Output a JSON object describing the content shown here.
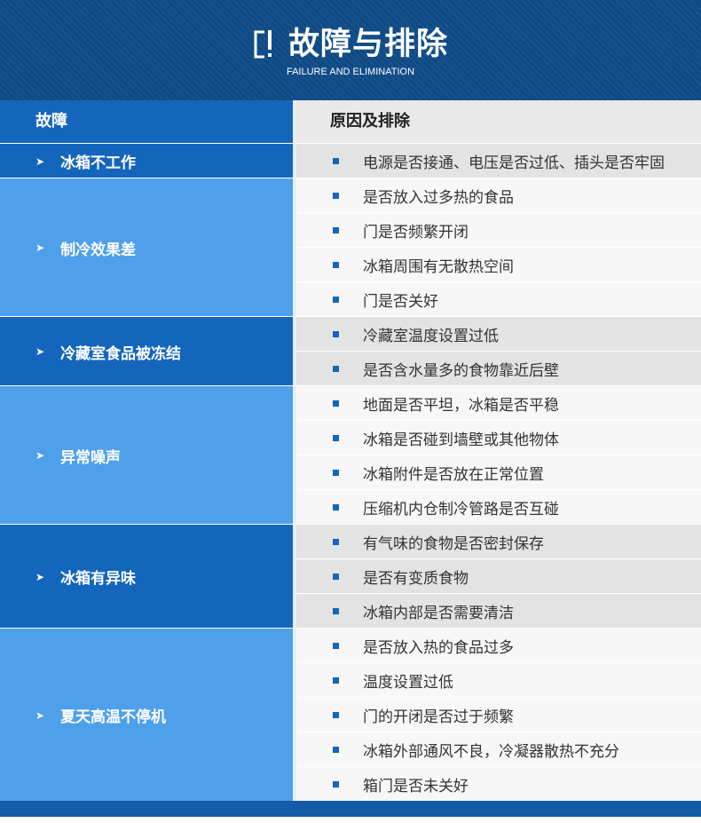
{
  "header": {
    "title": "故障与排除",
    "subtitle": "FAILURE AND ELIMINATION",
    "icon": "exclamation-bracket-icon"
  },
  "table": {
    "col_fault": "故障",
    "col_cause": "原因及排除",
    "rows": [
      {
        "fault": "冰箱不工作",
        "causes": [
          "电源是否接通、电压是否过低、插头是否牢固"
        ]
      },
      {
        "fault": "制冷效果差",
        "causes": [
          "是否放入过多热的食品",
          "门是否频繁开闭",
          "冰箱周围有无散热空间",
          "门是否关好"
        ]
      },
      {
        "fault": "冷藏室食品被冻结",
        "causes": [
          "冷藏室温度设置过低",
          "是否含水量多的食物靠近后壁"
        ]
      },
      {
        "fault": "异常噪声",
        "causes": [
          "地面是否平坦，冰箱是否平稳",
          "冰箱是否碰到墙壁或其他物体",
          "冰箱附件是否放在正常位置",
          "压缩机内仓制冷管路是否互碰"
        ]
      },
      {
        "fault": "冰箱有异味",
        "causes": [
          "有气味的食物是否密封保存",
          "是否有变质食物",
          "冰箱内部是否需要清洁"
        ]
      },
      {
        "fault": "夏天高温不停机",
        "causes": [
          "是否放入热的食品过多",
          "温度设置过低",
          "门的开闭是否过于频繁",
          "冰箱外部通风不良，冷凝器散热不充分",
          "箱门是否未关好"
        ]
      }
    ]
  },
  "colors": {
    "banner": "#0f4b86",
    "fault_dark": "#1466bd",
    "fault_light": "#4ea0ea",
    "bullet": "#1466bd"
  },
  "icons": {
    "row_marker": "arrow-right-icon",
    "cause_marker": "square-bullet-icon"
  }
}
